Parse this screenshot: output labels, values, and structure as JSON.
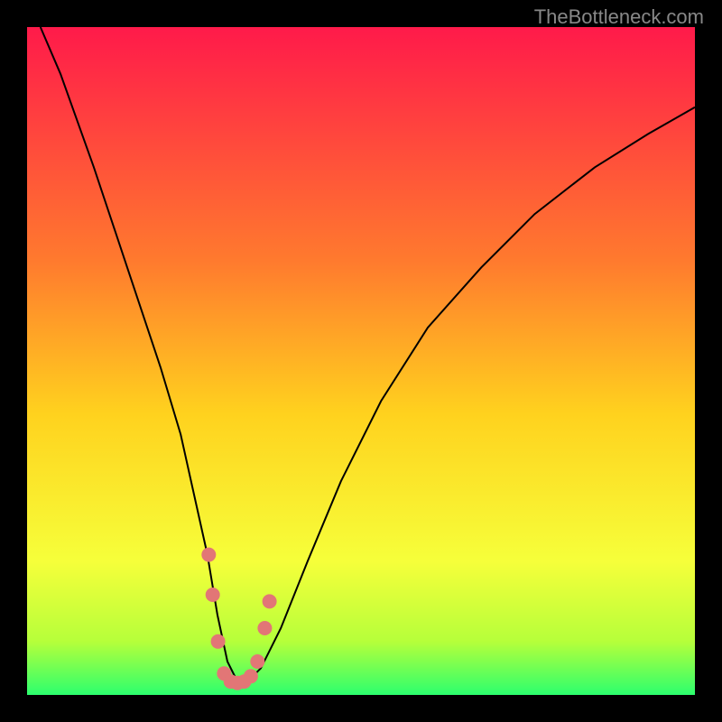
{
  "watermark": "TheBottleneck.com",
  "colors": {
    "top": "#ff1a4a",
    "mid_upper": "#ff7a2e",
    "mid": "#ffd21e",
    "mid_lower": "#f6ff3a",
    "lime": "#b6ff3a",
    "green": "#2cff6e",
    "marker": "#e27676",
    "curve": "#000000",
    "frame": "#000000"
  },
  "chart_data": {
    "type": "line",
    "title": "",
    "xlabel": "",
    "ylabel": "",
    "xlim": [
      0,
      100
    ],
    "ylim": [
      0,
      100
    ],
    "x": [
      2,
      5,
      10,
      15,
      20,
      23,
      25,
      27,
      28.5,
      30,
      31.5,
      33,
      35,
      38,
      42,
      47,
      53,
      60,
      68,
      76,
      85,
      93,
      100
    ],
    "values": [
      100,
      93,
      79,
      64,
      49,
      39,
      30,
      21,
      12,
      5,
      2,
      2,
      4,
      10,
      20,
      32,
      44,
      55,
      64,
      72,
      79,
      84,
      88
    ],
    "markers": [
      {
        "x": 27.2,
        "y": 21
      },
      {
        "x": 27.8,
        "y": 15
      },
      {
        "x": 28.6,
        "y": 8
      },
      {
        "x": 29.5,
        "y": 3.2
      },
      {
        "x": 30.5,
        "y": 2.0
      },
      {
        "x": 31.5,
        "y": 1.8
      },
      {
        "x": 32.5,
        "y": 2.0
      },
      {
        "x": 33.5,
        "y": 2.8
      },
      {
        "x": 34.5,
        "y": 5
      },
      {
        "x": 35.6,
        "y": 10
      },
      {
        "x": 36.3,
        "y": 14
      }
    ],
    "gradient_stops": [
      {
        "pos": 0.0,
        "key": "top"
      },
      {
        "pos": 0.35,
        "key": "mid_upper"
      },
      {
        "pos": 0.58,
        "key": "mid"
      },
      {
        "pos": 0.8,
        "key": "mid_lower"
      },
      {
        "pos": 0.92,
        "key": "lime"
      },
      {
        "pos": 1.0,
        "key": "green"
      }
    ]
  }
}
